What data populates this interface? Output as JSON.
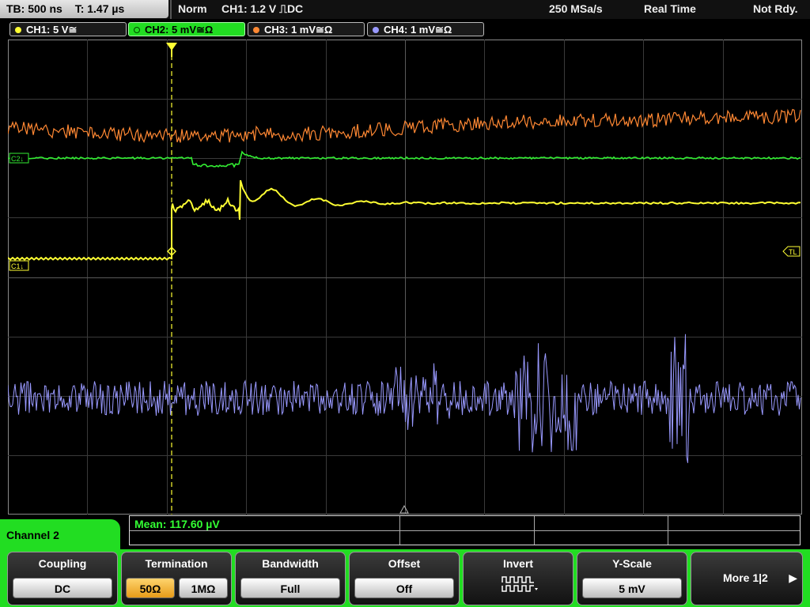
{
  "top_bar": {
    "timebase": "TB: 500 ns",
    "trigger_time": "T: 1.47 µs",
    "trigger_mode": "Norm",
    "trigger_info": "CH1: 1.2 V ⎍DC",
    "sample_rate": "250 MSa/s",
    "acq_mode": "Real Time",
    "status": "Not Rdy."
  },
  "channels": [
    {
      "id": "ch1",
      "label": "CH1: 5 V≅",
      "color": "#ffff33"
    },
    {
      "id": "ch2",
      "label": "CH2: 5 mV≅Ω",
      "color": "#33ee33"
    },
    {
      "id": "ch3",
      "label": "CH3: 1 mV≅Ω",
      "color": "#ff8833"
    },
    {
      "id": "ch4",
      "label": "CH4: 1 mV≅Ω",
      "color": "#9999ff"
    }
  ],
  "markers": {
    "c1": "C1↓",
    "c2": "C2↓",
    "trigger_level": "TL"
  },
  "measurement": {
    "label": "Mean: 117.60 µV"
  },
  "menu": {
    "title": "Channel 2",
    "coupling": {
      "title": "Coupling",
      "value": "DC"
    },
    "termination": {
      "title": "Termination",
      "options": [
        "50Ω",
        "1MΩ"
      ],
      "selected": "50Ω"
    },
    "bandwidth": {
      "title": "Bandwidth",
      "value": "Full"
    },
    "offset": {
      "title": "Offset",
      "value": "Off"
    },
    "invert": {
      "title": "Invert"
    },
    "y_scale": {
      "title": "Y-Scale",
      "value": "5 mV"
    },
    "more": {
      "label": "More 1|2"
    }
  }
}
